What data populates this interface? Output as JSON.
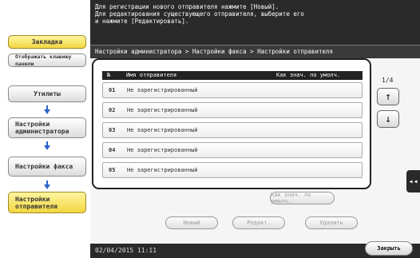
{
  "help_text": "Для регистрации нового отправителя нажмите [Новый].\nДля редактирования существующего отправителя, выберите его\nи нажмите [Редактировать].",
  "breadcrumb": "Настройки администратора > Настройки факса > Настройки отправителя",
  "left_panel": {
    "bookmark": "Закладка",
    "show_panel": "Отображать клавишу панели",
    "utilities": "Утилиты",
    "admin_settings": "Настройки администратора",
    "fax_settings": "Настройки факса",
    "sender_settings": "Настройки отправителя"
  },
  "list": {
    "header_num": "№",
    "header_name": "Имя отправителя",
    "header_default": "Как знач. по умолч.",
    "rows": [
      {
        "num": "01",
        "name": "Не зарегистрированный"
      },
      {
        "num": "02",
        "name": "Не зарегистрированный"
      },
      {
        "num": "03",
        "name": "Не зарегистрированный"
      },
      {
        "num": "04",
        "name": "Не зарегистрированный"
      },
      {
        "num": "05",
        "name": "Не зарегистрированный"
      }
    ]
  },
  "pagination": {
    "page": "1/4",
    "up": "↑",
    "down": "↓"
  },
  "side_tab": "◂◂",
  "buttons": {
    "set_default": "Как знач. по умолч.",
    "new": "Новый",
    "edit": "Редакт.",
    "delete": "Удалить",
    "close": "Закрыть"
  },
  "status": {
    "datetime": "02/04/2015 11:11"
  },
  "colors": {
    "accent": "#2b63c9",
    "highlight": "#f2d640",
    "dark": "#2a2a2a"
  }
}
